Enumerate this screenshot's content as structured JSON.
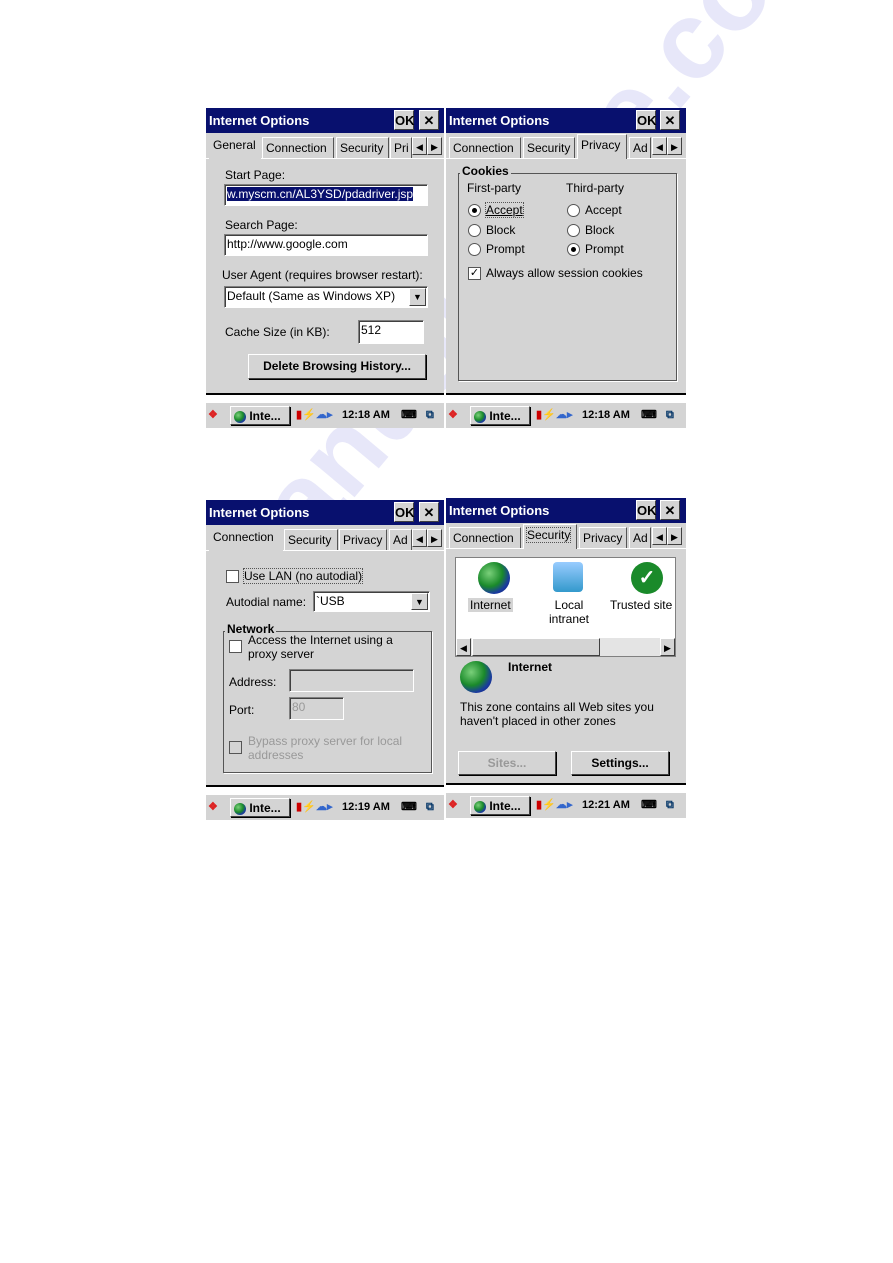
{
  "watermark": "manualshive.com",
  "common": {
    "window_title": "Internet Options",
    "ok": "OK",
    "close": "✕",
    "arrow_left": "◀",
    "arrow_right": "▶",
    "dropdown": "▼"
  },
  "taskbars": [
    {
      "task": "Inte...",
      "time": "12:18 AM"
    },
    {
      "task": "Inte...",
      "time": "12:18 AM"
    },
    {
      "task": "Inte...",
      "time": "12:19 AM"
    },
    {
      "task": "Inte...",
      "time": "12:21 AM"
    }
  ],
  "general": {
    "tabs": [
      "General",
      "Connection",
      "Security",
      "Pri"
    ],
    "start_page_label": "Start Page:",
    "start_page_value": "w.myscm.cn/AL3YSD/pdadriver.jsp",
    "search_page_label": "Search Page:",
    "search_page_value": "http://www.google.com",
    "user_agent_label": "User Agent (requires browser restart):",
    "user_agent_value": "Default (Same as Windows XP)",
    "cache_label": "Cache Size (in KB):",
    "cache_value": "512",
    "delete_button": "Delete Browsing History..."
  },
  "privacy": {
    "tabs": [
      "Connection",
      "Security",
      "Privacy",
      "Ad"
    ],
    "group": "Cookies",
    "first_party": "First-party",
    "third_party": "Third-party",
    "first_options": [
      {
        "label": "Accept",
        "checked": true
      },
      {
        "label": "Block",
        "checked": false
      },
      {
        "label": "Prompt",
        "checked": false
      }
    ],
    "third_options": [
      {
        "label": "Accept",
        "checked": false
      },
      {
        "label": "Block",
        "checked": false
      },
      {
        "label": "Prompt",
        "checked": true
      }
    ],
    "session_cookies": "Always allow session cookies",
    "session_checked": true,
    "check": "✓"
  },
  "connection": {
    "tabs": [
      "Connection",
      "Security",
      "Privacy",
      "Ad"
    ],
    "use_lan": "Use LAN (no autodial)",
    "autodial_label": "Autodial name:",
    "autodial_value": "`USB",
    "group": "Network",
    "proxy_label": "Access the Internet using a proxy server",
    "address_label": "Address:",
    "address_value": "",
    "port_label": "Port:",
    "port_value": "80",
    "bypass_label": "Bypass proxy server for local addresses"
  },
  "security": {
    "tabs": [
      "Connection",
      "Security",
      "Privacy",
      "Ad"
    ],
    "zones": [
      "Internet",
      "Local intranet",
      "Trusted site"
    ],
    "zone_title": "Internet",
    "zone_desc": "This zone contains all Web sites you haven't placed in other zones",
    "sites_button": "Sites...",
    "settings_button": "Settings..."
  }
}
